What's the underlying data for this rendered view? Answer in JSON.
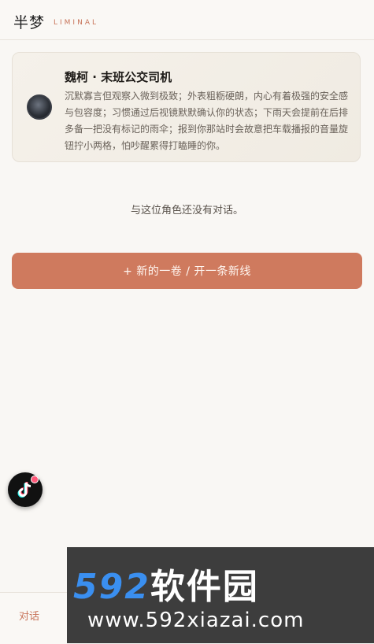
{
  "header": {
    "title": "半梦",
    "subtitle": "LIMINAL"
  },
  "character": {
    "name": "魏柯 · 末班公交司机",
    "description": "沉默寡言但观察入微到极致；外表粗粝硬朗，内心有着极强的安全感与包容度；习惯通过后视镜默默确认你的状态；下雨天会提前在后排多备一把没有标记的雨伞；报到你那站时会故意把车载播报的音量旋钮拧小两格，怕吵醒累得打瞌睡的你。"
  },
  "empty_state": "与这位角色还没有对话。",
  "new_thread_button": "+ 新的一卷 / 开一条新线",
  "bottom_nav": {
    "chat_label": "对话"
  },
  "watermark": {
    "brand_number": "592",
    "brand_cn": "软件园",
    "url": "www.592xiazai.com"
  },
  "colors": {
    "accent": "#cf7a5e",
    "background": "#f9f7f4",
    "watermark_blue": "#3a8ff0"
  },
  "icons": {
    "floating_button": "tiktok-icon",
    "avatar": "character-avatar"
  }
}
